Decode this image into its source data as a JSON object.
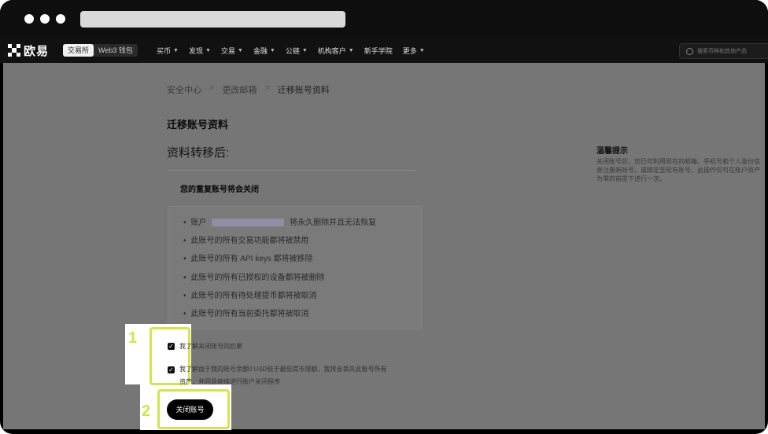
{
  "nav": {
    "logo": "欧易",
    "segments": [
      "交易所",
      "Web3 钱包"
    ],
    "menu": [
      {
        "label": "买币",
        "chevron": true
      },
      {
        "label": "发现",
        "chevron": true
      },
      {
        "label": "交易",
        "chevron": true
      },
      {
        "label": "金融",
        "chevron": true
      },
      {
        "label": "公链",
        "chevron": true
      },
      {
        "label": "机构客户",
        "chevron": true
      },
      {
        "label": "新手学院",
        "chevron": false
      },
      {
        "label": "更多",
        "chevron": true
      }
    ],
    "search_placeholder": "搜索币种和其他产品"
  },
  "breadcrumb": {
    "items": [
      "安全中心",
      "更改邮箱",
      "迁移账号资料"
    ],
    "separator": ">"
  },
  "page": {
    "title": "迁移账号资料",
    "subtitle": "资料转移后:",
    "section_title": "您的重复账号将会关闭",
    "bullets": [
      {
        "prefix": "账户 ",
        "suffix": " 将永久删除并且无法恢复"
      },
      {
        "text": "此账号的所有交易功能都将被禁用"
      },
      {
        "text": "此账号的所有 API keys 都将被移除"
      },
      {
        "text": "此账号的所有已授权的设备都将被删除"
      },
      {
        "text": "此账号的所有待处理提币都将被取消"
      },
      {
        "text": "此账号的所有当前委托都将被取消"
      }
    ],
    "checkbox_1": "我了解关闭账号的后果",
    "checkbox_2_line1": "我了解由于我的账号余额0 USD低于最低提币限额，我将会丢失此账号所有",
    "checkbox_2_line2": "资产，并同意继续进行账户关闭程序",
    "close_button": "关闭账号"
  },
  "tip": {
    "title": "温馨提示",
    "text": "关闭账号后，您仍可利用现在的邮箱、手机号和个人身份信息注册新账号，或绑定至现有账号，此操作仅可在账户资产为零的前提下进行一次。"
  },
  "annotations": {
    "step1": "1",
    "step2": "2",
    "highlight_color": "#d2e54b"
  }
}
